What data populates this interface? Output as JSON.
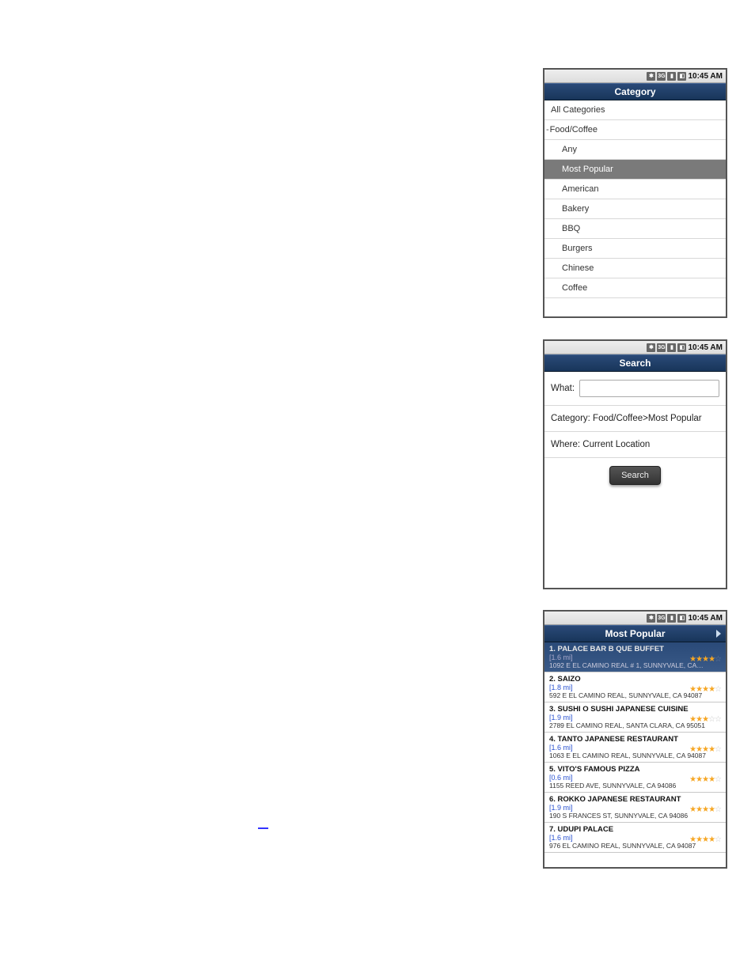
{
  "statusbar": {
    "time": "10:45 AM"
  },
  "phone1": {
    "title": "Category",
    "top": "All Categories",
    "parent": "Food/Coffee",
    "children": [
      "Any",
      "Most Popular",
      "American",
      "Bakery",
      "BBQ",
      "Burgers",
      "Chinese",
      "Coffee"
    ],
    "selected": "Most Popular"
  },
  "phone2": {
    "title": "Search",
    "whatLabel": "What:",
    "categoryLine": "Category: Food/Coffee>Most Popular",
    "whereLine": "Where: Current Location",
    "button": "Search"
  },
  "phone3": {
    "title": "Most Popular",
    "results": [
      {
        "n": "1",
        "name": "PALACE BAR B QUE BUFFET",
        "dist": "[1.6 mi]",
        "addr": "1092 E EL CAMINO REAL # 1, SUNNYVALE, CA…",
        "stars": 4
      },
      {
        "n": "2",
        "name": "SAIZO",
        "dist": "[1.8 mi]",
        "addr": "592 E EL CAMINO REAL, SUNNYVALE, CA 94087",
        "stars": 4
      },
      {
        "n": "3",
        "name": "SUSHI O SUSHI JAPANESE CUISINE",
        "dist": "[1.9 mi]",
        "addr": "2789 EL CAMINO REAL, SANTA CLARA, CA 95051",
        "stars": 3
      },
      {
        "n": "4",
        "name": "TANTO JAPANESE RESTAURANT",
        "dist": "[1.6 mi]",
        "addr": "1063 E EL CAMINO REAL, SUNNYVALE, CA 94087",
        "stars": 4
      },
      {
        "n": "5",
        "name": "VITO'S FAMOUS PIZZA",
        "dist": "[0.6 mi]",
        "addr": "1155 REED AVE, SUNNYVALE, CA 94086",
        "stars": 3.5
      },
      {
        "n": "6",
        "name": "ROKKO JAPANESE RESTAURANT",
        "dist": "[1.9 mi]",
        "addr": "190 S FRANCES ST, SUNNYVALE, CA 94086",
        "stars": 4
      },
      {
        "n": "7",
        "name": "UDUPI PALACE",
        "dist": "[1.6 mi]",
        "addr": "976 EL CAMINO REAL, SUNNYVALE, CA 94087",
        "stars": 4
      }
    ]
  }
}
